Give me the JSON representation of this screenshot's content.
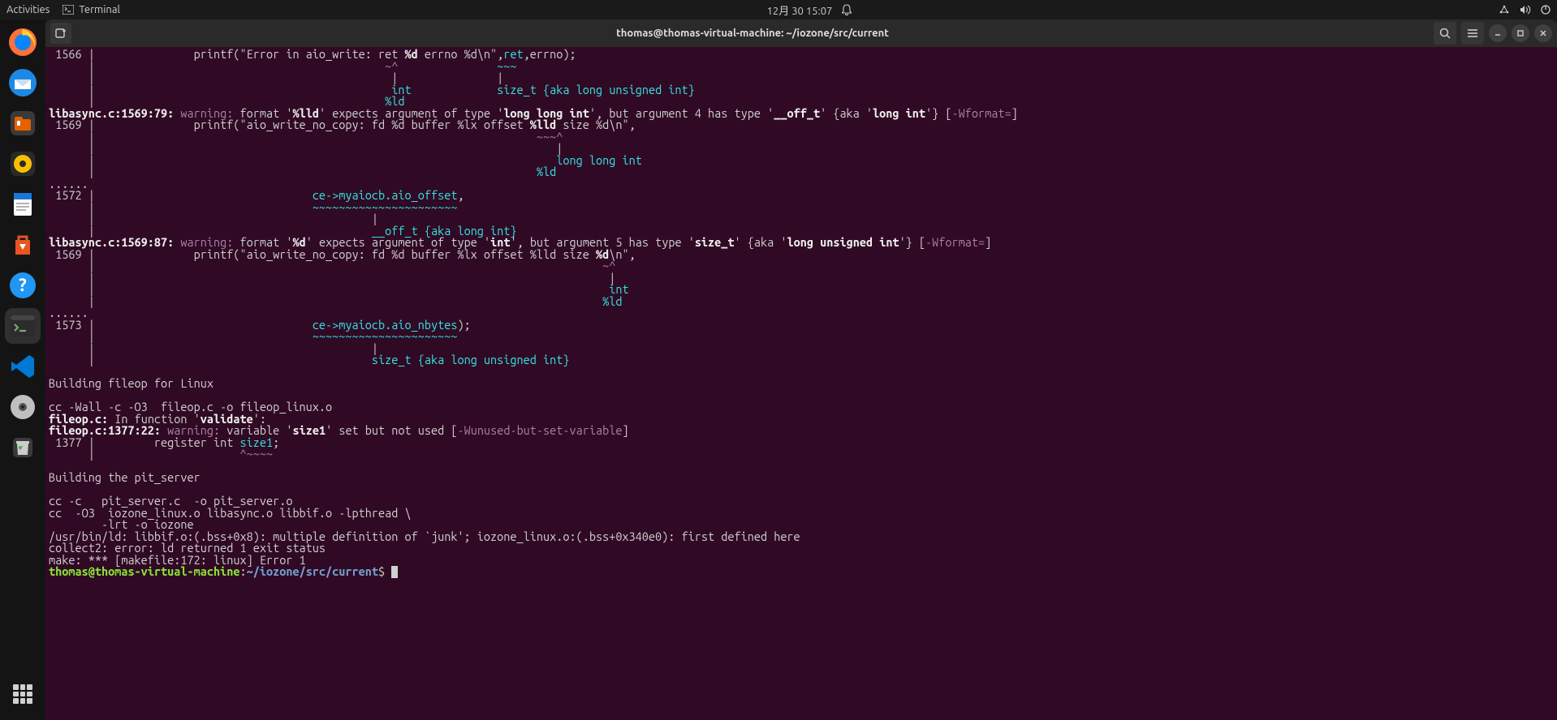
{
  "topbar": {
    "activities": "Activities",
    "app": "Terminal",
    "clock": "12月 30  15:07"
  },
  "window": {
    "title": "thomas@thomas-virtual-machine: ~/iozone/src/current"
  },
  "term": {
    "l1a": " 1566 |               printf(\"Error in aio_write: ret ",
    "l1_fmt": "%d",
    "l1b": " errno %d\\n\",",
    "l1_ret": "ret",
    "l1c": ",errno);",
    "l2": "      |                                            ",
    "l2_mark": "~^",
    "l2_sp": "               ",
    "l2_mark2": "~~~",
    "l3": "      |                                             |               |",
    "l4": "      |                                             ",
    "l4_int": "int",
    "l4_sp": "             ",
    "l4_sizet": "size_t {aka long unsigned int}",
    "l5": "      |                                            ",
    "l5_ld": "%ld",
    "l6_loc": "libasync.c:1569:79: ",
    "l6_warn": "warning: ",
    "l6_a": "format '",
    "l6_lld": "%lld",
    "l6_b": "' expects argument of type '",
    "l6_lli": "long long int",
    "l6_c": "', but argument 4 has type '",
    "l6_off": "__off_t",
    "l6_d": "' {aka '",
    "l6_li": "long int",
    "l6_e": "'} [",
    "l6_wf": "-Wformat=",
    "l6_f": "]",
    "l7": " 1569 |               printf(\"aio_write_no_copy: fd %d buffer %lx offset ",
    "l7_lld": "%lld",
    "l7b": " size %d\\n\",",
    "l8": "      |                                                                   ",
    "l8_mark": "~~~^",
    "l9": "      |                                                                      |",
    "l10": "      |                                                                      ",
    "l10_lli": "long long int",
    "l11": "      |                                                                   ",
    "l11_ld": "%ld",
    "l12": "......",
    "l13": " 1572 |                                 ",
    "l13_expr": "ce->myaiocb.aio_offset",
    "l13b": ",",
    "l14": "      |                                 ",
    "l14_mark": "~~~~~~~~~~~~~~~~~~~~~~",
    "l15": "      |                                          |",
    "l16": "      |                                          ",
    "l16_off": "__off_t {aka long int}",
    "l17_loc": "libasync.c:1569:87: ",
    "l17_warn": "warning: ",
    "l17_a": "format '",
    "l17_d": "%d",
    "l17_b": "' expects argument of type '",
    "l17_int": "int",
    "l17_c": "', but argument 5 has type '",
    "l17_sizet": "size_t",
    "l17_d2": "' {aka '",
    "l17_lui": "long unsigned int",
    "l17_e": "'} [",
    "l17_wf": "-Wformat=",
    "l17_f": "]",
    "l18": " 1569 |               printf(\"aio_write_no_copy: fd %d buffer %lx offset %lld size ",
    "l18_d": "%d",
    "l18b": "\\n\",",
    "l19": "      |                                                                             ",
    "l19_mark": "~^",
    "l20": "      |                                                                              |",
    "l21": "      |                                                                              ",
    "l21_int": "int",
    "l22": "      |                                                                             ",
    "l22_ld": "%ld",
    "l23": "......",
    "l24": " 1573 |                                 ",
    "l24_expr": "ce->myaiocb.aio_nbytes",
    "l24b": ");",
    "l25": "      |                                 ",
    "l25_mark": "~~~~~~~~~~~~~~~~~~~~~~",
    "l26": "      |                                          |",
    "l27": "      |                                          ",
    "l27_sizet": "size_t {aka long unsigned int}",
    "l28": "",
    "l29": "Building fileop for Linux",
    "l30": "",
    "l31": "cc -Wall -c -O3  fileop.c -o fileop_linux.o",
    "l32_loc": "fileop.c:",
    "l32_fn": " In function '",
    "l32_v": "validate",
    "l32_b": "':",
    "l33_loc": "fileop.c:1377:22: ",
    "l33_warn": "warning: ",
    "l33_a": "variable '",
    "l33_sz": "size1",
    "l33_b": "' set but not used [",
    "l33_wf": "-Wunused-but-set-variable",
    "l33_c": "]",
    "l34": " 1377 |         register int ",
    "l34_sz": "size1",
    "l34b": ";",
    "l35": "      |                      ",
    "l35_mark": "^~~~~",
    "l36": "",
    "l37": "Building the pit_server",
    "l38": "",
    "l39": "cc -c   pit_server.c  -o pit_server.o",
    "l40": "cc  -O3  iozone_linux.o libasync.o libbif.o -lpthread \\",
    "l41": "        -lrt -o iozone",
    "l42": "/usr/bin/ld: libbif.o:(.bss+0x8): multiple definition of `junk'; iozone_linux.o:(.bss+0x340e0): first defined here",
    "l43": "collect2: error: ld returned 1 exit status",
    "l44": "make: *** [makefile:172: linux] Error 1",
    "p_user": "thomas@thomas-virtual-machine",
    "p_colon": ":",
    "p_path": "~/iozone/src/current",
    "p_dollar": "$ "
  }
}
